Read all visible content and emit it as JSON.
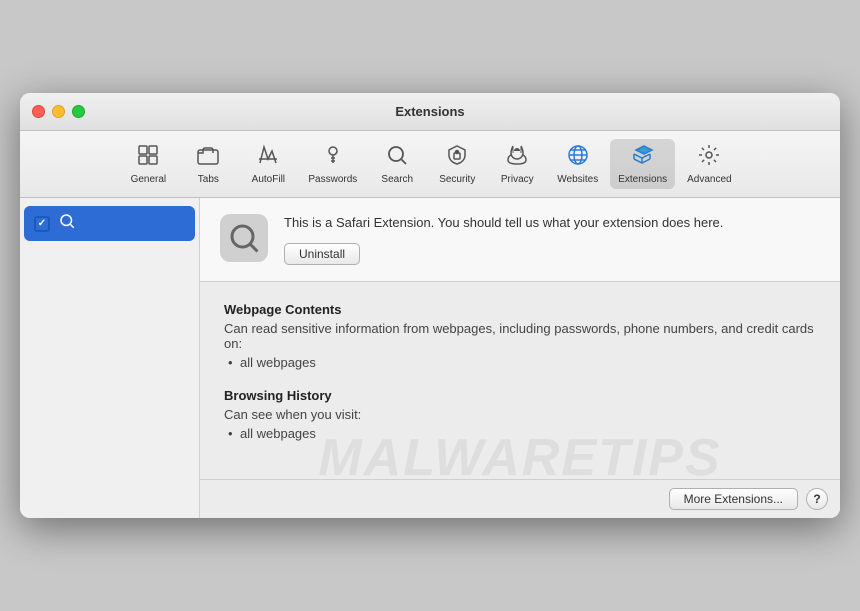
{
  "window": {
    "title": "Extensions"
  },
  "toolbar": {
    "items": [
      {
        "id": "general",
        "label": "General",
        "icon": "⬛"
      },
      {
        "id": "tabs",
        "label": "Tabs",
        "icon": "📋"
      },
      {
        "id": "autofill",
        "label": "AutoFill",
        "icon": "✏️"
      },
      {
        "id": "passwords",
        "label": "Passwords",
        "icon": "🔑"
      },
      {
        "id": "search",
        "label": "Search",
        "icon": "🔍"
      },
      {
        "id": "security",
        "label": "Security",
        "icon": "🔒"
      },
      {
        "id": "privacy",
        "label": "Privacy",
        "icon": "✋"
      },
      {
        "id": "websites",
        "label": "Websites",
        "icon": "🌐"
      },
      {
        "id": "extensions",
        "label": "Extensions",
        "icon": "⚡"
      },
      {
        "id": "advanced",
        "label": "Advanced",
        "icon": "⚙️"
      }
    ],
    "active": "extensions"
  },
  "sidebar": {
    "items": [
      {
        "id": "search-ext",
        "checked": true,
        "icon": "🔍",
        "label": ""
      }
    ]
  },
  "extension": {
    "icon": "🔍",
    "description": "This is a Safari Extension. You should tell us what your extension does here.",
    "uninstall_label": "Uninstall"
  },
  "permissions": {
    "webpage_contents": {
      "title": "Webpage Contents",
      "description": "Can read sensitive information from webpages, including passwords, phone numbers, and credit cards on:",
      "items": [
        "all webpages"
      ]
    },
    "browsing_history": {
      "title": "Browsing History",
      "description": "Can see when you visit:",
      "items": [
        "all webpages"
      ]
    }
  },
  "bottom_bar": {
    "more_extensions_label": "More Extensions...",
    "help_label": "?"
  },
  "watermark": {
    "text": "MALWARETIPS"
  }
}
